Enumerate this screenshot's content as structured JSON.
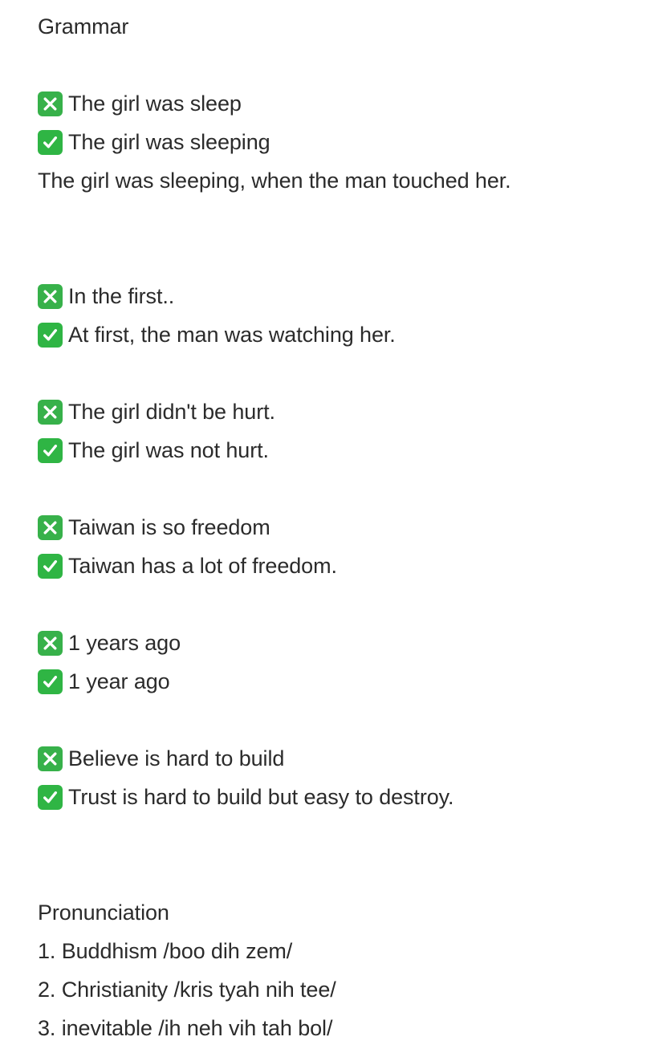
{
  "grammar": {
    "heading": "Grammar",
    "intro": {
      "wrong": "The girl was sleep",
      "right": "The girl was sleeping",
      "example": "The girl was sleeping, when the man touched her."
    },
    "pairs": [
      {
        "wrong": "In the first..",
        "right": "At first, the man was watching her."
      },
      {
        "wrong": "The girl didn't be hurt.",
        "right": "The girl was not hurt."
      },
      {
        "wrong": "Taiwan is so freedom",
        "right": "Taiwan has a lot of freedom."
      },
      {
        "wrong": "1 years ago",
        "right": "1 year ago"
      },
      {
        "wrong": "Believe is hard to build",
        "right": "Trust is hard to build but easy to destroy."
      }
    ]
  },
  "pronunciation": {
    "heading": "Pronunciation",
    "items": [
      "1. Buddhism /boo dih zem/",
      "2. Christianity /kris tyah nih tee/",
      "3. inevitable /ih neh vih tah bol/"
    ]
  },
  "icons": {
    "wrong": "cross-mark-button-icon",
    "right": "check-mark-button-icon",
    "color": "#2fb544"
  }
}
